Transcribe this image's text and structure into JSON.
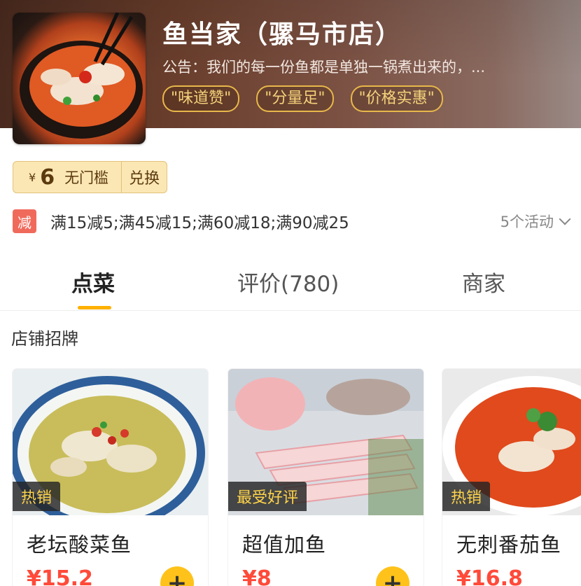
{
  "shop": {
    "name": "鱼当家（骡马市店）",
    "notice": "公告：我们的每一份鱼都是单独一锅煮出来的，...",
    "tags": [
      "\"味道赞\"",
      "\"分量足\"",
      "\"价格实惠\""
    ]
  },
  "coupon": {
    "currency": "¥",
    "amount": "6",
    "condition": "无门槛",
    "action": "兑换"
  },
  "promo": {
    "badge": "减",
    "text": "满15减5;满45减15;满60减18;满90减25",
    "more": "5个活动"
  },
  "tabs": [
    "点菜",
    "评价(780)",
    "商家"
  ],
  "section": {
    "title": "店铺招牌"
  },
  "items": [
    {
      "name": "老坛酸菜鱼",
      "price": "¥15.2",
      "badge": "热销"
    },
    {
      "name": "超值加鱼",
      "price": "¥8",
      "badge": "最受好评"
    },
    {
      "name": "无刺番茄鱼",
      "price": "¥16.8",
      "badge": "热销"
    }
  ],
  "add_label": "+",
  "colors": {
    "accent": "#ffb000",
    "price": "#ff4a3a",
    "promo_badge": "#f06a5c",
    "tag_border": "#e8b84a"
  },
  "icons": [
    "shop-logo-image",
    "chevron-down-icon",
    "plus-icon"
  ]
}
